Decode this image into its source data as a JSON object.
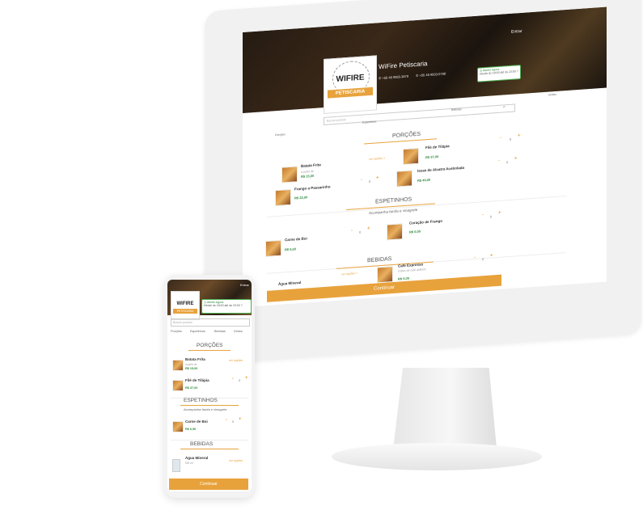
{
  "desktop": {
    "brand": {
      "logo_text": "WIFIRE",
      "logo_ribbon": "PETISCARIA",
      "title": "WiFire Petiscaria"
    },
    "header": {
      "entrar": "Entrar",
      "phone": "+55 48 9955-3879",
      "whatsapp": "+55 48 9933-0788"
    },
    "status": {
      "open_label": "Aberto Agora",
      "hours": "Desde às 18:00 até às 23:00 ?"
    },
    "search": {
      "placeholder": "Buscar produto"
    },
    "tabs": [
      "Porções",
      "Espetinhos",
      "Bebidas",
      "Drinks"
    ],
    "sections": {
      "porcoes": {
        "title": "PORÇÕES",
        "items": [
          {
            "name": "Batata Frita",
            "sub": "a partir de",
            "price": "R$ 15,00",
            "options": "ver opções >"
          },
          {
            "name": "Filé de Tilápia",
            "price": "R$ 37,00",
            "qty": "0"
          },
          {
            "name": "Frango a Passarinho",
            "price": "R$ 22,00",
            "qty": "0"
          },
          {
            "name": "Iscas de Alcatra Acebolada",
            "price": "R$ 40,00",
            "qty": "0"
          }
        ]
      },
      "espetinhos": {
        "title": "ESPETINHOS",
        "note": "Acompanha farofa e vinagrete",
        "items": [
          {
            "name": "Carne de Boi",
            "price": "R$ 6,50",
            "qty": "0"
          },
          {
            "name": "Coração de Frango",
            "price": "R$ 6,00",
            "qty": "0"
          }
        ]
      },
      "bebidas": {
        "title": "BEBIDAS",
        "items": [
          {
            "name": "Água Mineral",
            "options": "ver opções >"
          },
          {
            "name": "Café Expresso",
            "sub": "Grãos de café arábica",
            "price": "R$ 5,00",
            "qty": "0"
          }
        ]
      }
    },
    "continue_label": "Continuar"
  },
  "mobile": {
    "brand": {
      "logo_text": "WIFIRE",
      "logo_ribbon": "PETISCARIA"
    },
    "header": {
      "entrar": "Entrar"
    },
    "status": {
      "open_label": "Aberto Agora",
      "hours": "Desde às 18:00 até às 23:00 ?"
    },
    "search": {
      "placeholder": "Buscar produto"
    },
    "tabs": [
      "Porções",
      "Espetinhos",
      "Bebidas",
      "Drinks"
    ],
    "sections": {
      "porcoes": {
        "title": "PORÇÕES",
        "items": [
          {
            "name": "Batata Frita",
            "sub": "a partir de",
            "price": "R$ 15,00",
            "options": "ver opções"
          },
          {
            "name": "Filé de Tilápia",
            "price": "R$ 37,00",
            "qty": "0"
          }
        ]
      },
      "espetinhos": {
        "title": "ESPETINHOS",
        "note": "Acompanha farofa e vinagrete",
        "items": [
          {
            "name": "Carne de Boi",
            "price": "R$ 6,50",
            "qty": "0"
          }
        ]
      },
      "bebidas": {
        "title": "BEBIDAS",
        "items": [
          {
            "name": "Água Mineral",
            "sub": "500 ml",
            "options": "ver opções"
          }
        ]
      }
    },
    "continue_label": "Continuar"
  },
  "colors": {
    "accent": "#e8a23c",
    "price_green": "#2e8b3e",
    "status_green": "#4caf50"
  },
  "icons": [
    "phone-icon",
    "whatsapp-icon",
    "search-icon",
    "clock-icon",
    "plus-icon",
    "minus-icon"
  ]
}
